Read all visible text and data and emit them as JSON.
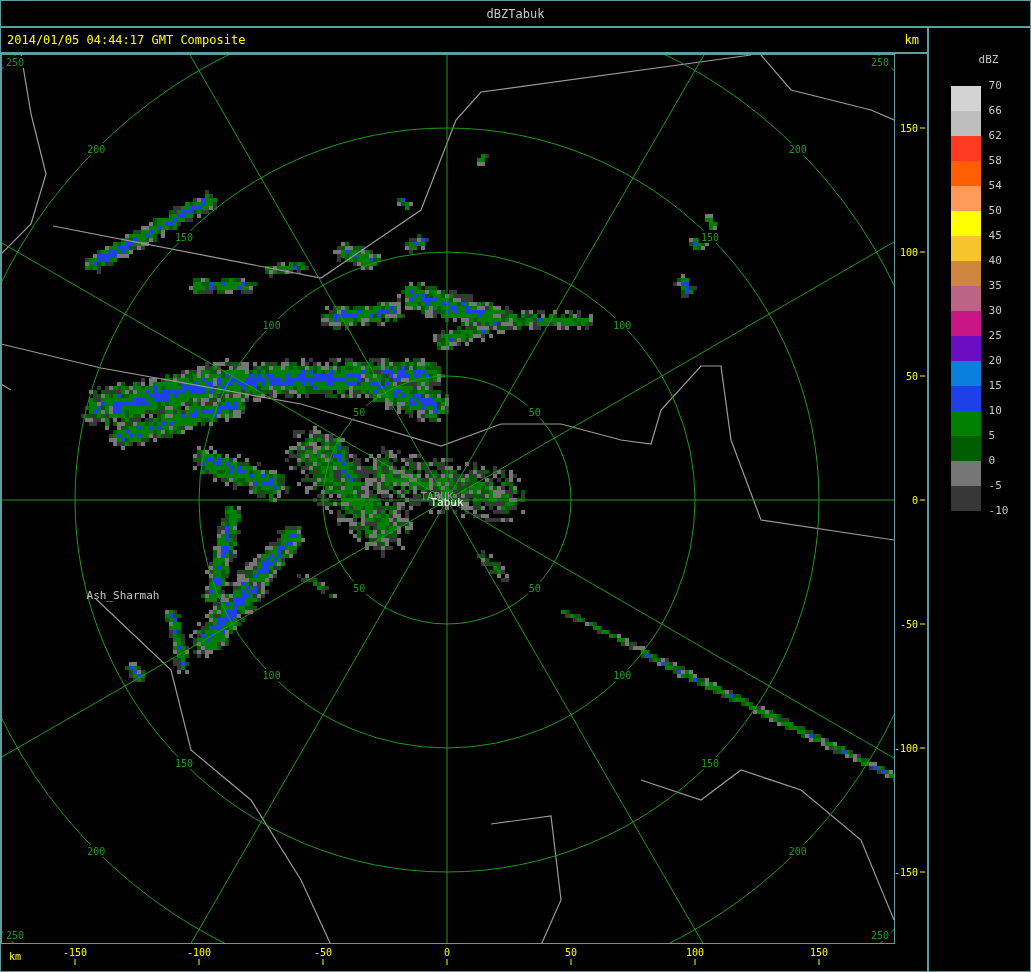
{
  "window": {
    "title": "dBZTabuk"
  },
  "header": {
    "timestamp": "2014/01/05 04:44:17 GMT Composite",
    "unit": "km"
  },
  "range_rings": [
    {
      "labels": [
        "50",
        "50",
        "50",
        "50"
      ]
    },
    {
      "labels": [
        "100",
        "100",
        "100",
        "100"
      ]
    },
    {
      "labels": [
        "150",
        "150",
        "150",
        "150"
      ]
    },
    {
      "labels": [
        "200",
        "200",
        "200",
        "200"
      ]
    },
    {
      "labels": [
        "250",
        "250",
        "250",
        "250"
      ]
    }
  ],
  "places": [
    {
      "name": "Ash_Sharmah"
    },
    {
      "name": "TABUK"
    },
    {
      "name": "Tabuk"
    }
  ],
  "y_axis": {
    "ticks": [
      "150",
      "100",
      "50",
      "0",
      "-50",
      "-100",
      "-150"
    ]
  },
  "x_axis": {
    "unit": "km",
    "ticks": [
      "-150",
      "-100",
      "-50",
      "0",
      "50",
      "100",
      "150"
    ]
  },
  "legend": {
    "title": "dBZ",
    "ticks": [
      "70",
      "66",
      "62",
      "58",
      "54",
      "50",
      "45",
      "40",
      "35",
      "30",
      "25",
      "20",
      "15",
      "10",
      "5",
      "0",
      "-5",
      "-10"
    ],
    "bands": [
      {
        "color": "#d3d3d3"
      },
      {
        "color": "#bebebe"
      },
      {
        "color": "#ff3a20"
      },
      {
        "color": "#ff5f00"
      },
      {
        "color": "#ff9a5a"
      },
      {
        "color": "#ffff00"
      },
      {
        "color": "#f7c42e"
      },
      {
        "color": "#cd853f"
      },
      {
        "color": "#bc6484"
      },
      {
        "color": "#c71585"
      },
      {
        "color": "#6a0dc3"
      },
      {
        "color": "#0a80dc"
      },
      {
        "color": "#1e40e8"
      },
      {
        "color": "#008000"
      },
      {
        "color": "#005e00"
      },
      {
        "color": "#767676"
      },
      {
        "color": "#373737"
      }
    ]
  }
}
